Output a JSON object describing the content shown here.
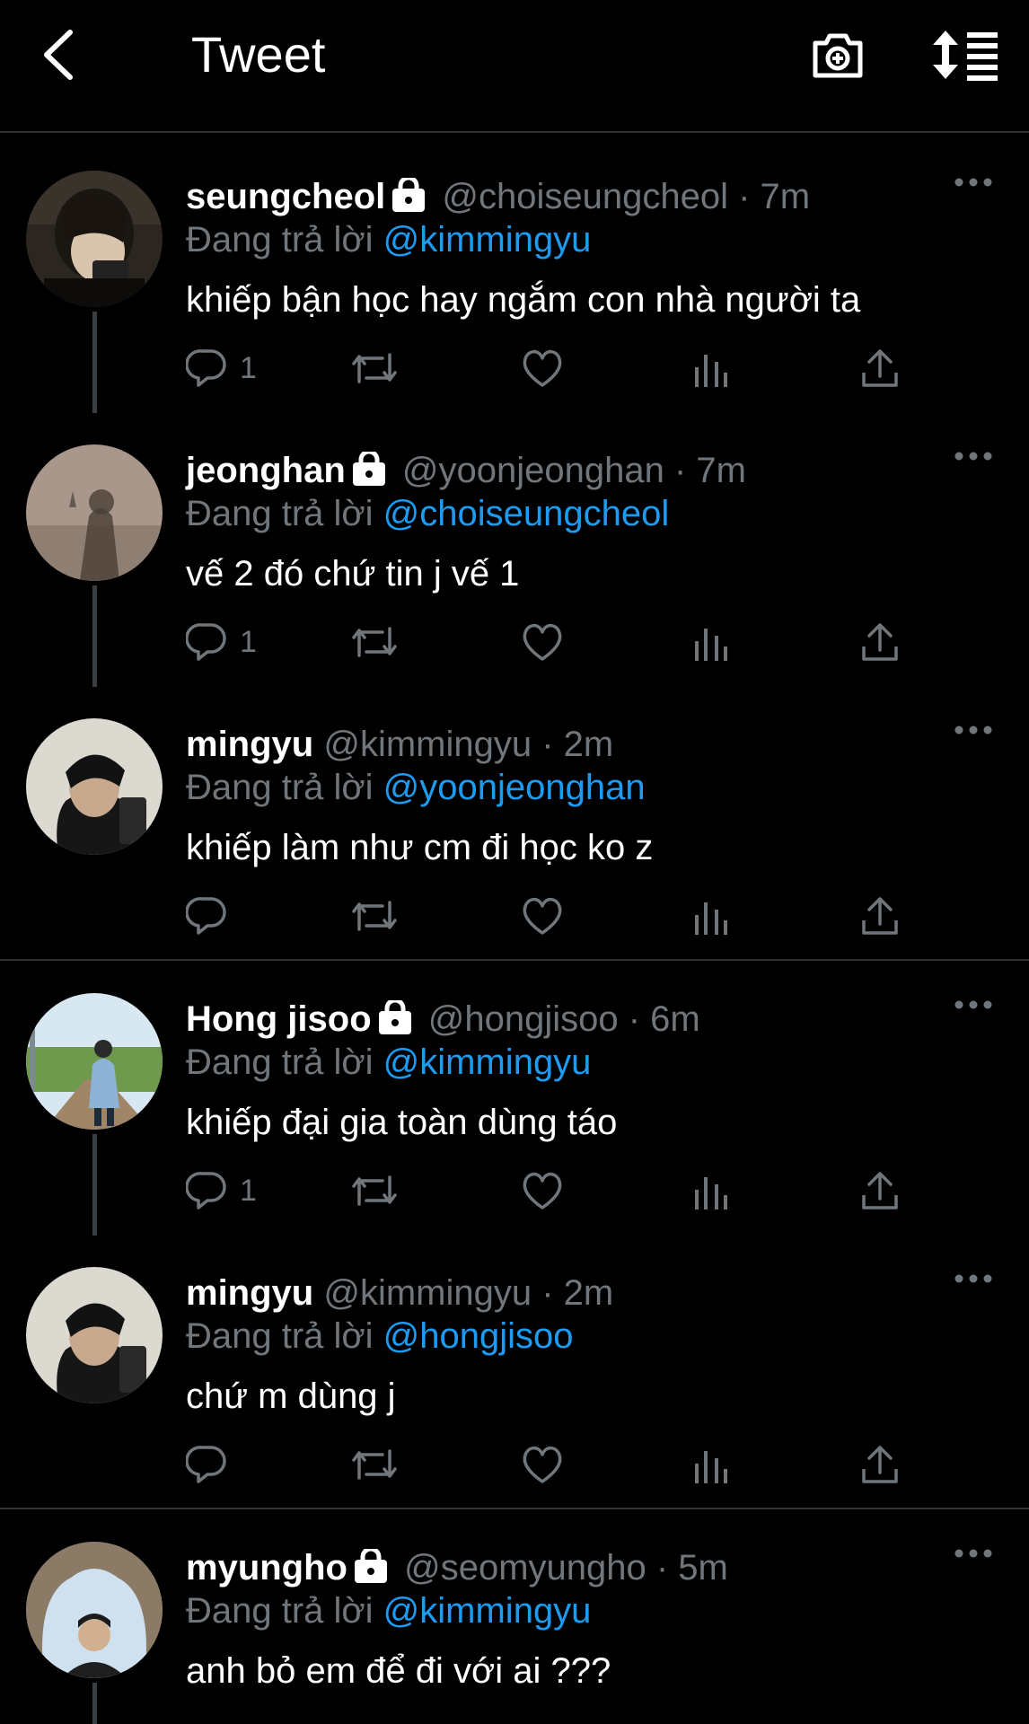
{
  "header": {
    "title": "Tweet"
  },
  "tweets": [
    {
      "name": "seungcheol",
      "handle": "@choiseungcheol · 7m",
      "reply_prefix": "Đang trả lời",
      "reply_to": "@kimmingyu",
      "text": "khiếp bận học hay ngắm con nhà người ta",
      "reply_count": "1",
      "locked": true
    },
    {
      "name": "jeonghan",
      "handle": "@yoonjeonghan · 7m",
      "reply_prefix": "Đang trả lời",
      "reply_to": "@choiseungcheol",
      "text": "vế 2 đó chứ tin j vế 1",
      "reply_count": "1",
      "locked": true
    },
    {
      "name": "mingyu",
      "handle": "@kimmingyu · 2m",
      "reply_prefix": "Đang trả lời",
      "reply_to": "@yoonjeonghan",
      "text": "khiếp làm như cm đi học ko z",
      "reply_count": "",
      "locked": false
    },
    {
      "name": "Hong jisoo",
      "handle": "@hongjisoo · 6m",
      "reply_prefix": "Đang trả lời",
      "reply_to": "@kimmingyu",
      "text": "khiếp đại gia toàn dùng táo",
      "reply_count": "1",
      "locked": true
    },
    {
      "name": "mingyu",
      "handle": "@kimmingyu · 2m",
      "reply_prefix": "Đang trả lời",
      "reply_to": "@hongjisoo",
      "text": "chứ m dùng j",
      "reply_count": "",
      "locked": false
    },
    {
      "name": "myungho",
      "handle": "@seomyungho · 5m",
      "reply_prefix": "Đang trả lời",
      "reply_to": "@kimmingyu",
      "text": "anh bỏ em để đi với ai ???",
      "reply_count": "",
      "locked": true
    }
  ],
  "colors": {
    "background": "#000000",
    "text": "#ffffff",
    "secondary": "#71767b",
    "accent": "#1d9bf0",
    "divider": "#2f3336"
  }
}
